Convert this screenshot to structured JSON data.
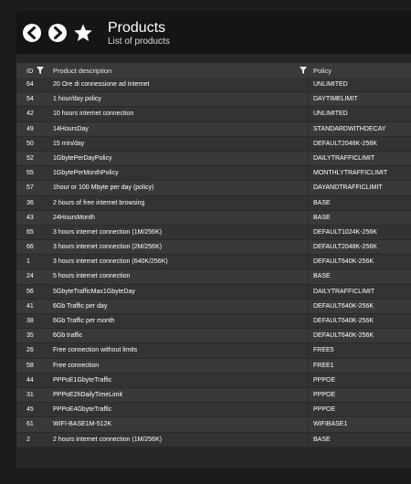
{
  "header": {
    "title": "Products",
    "subtitle": "List of products",
    "icons": [
      "back-circle-icon",
      "forward-circle-icon",
      "star-icon"
    ]
  },
  "columns": {
    "id": "ID",
    "description": "Product description",
    "policy": "Policy"
  },
  "rows": [
    {
      "id": "64",
      "description": "20 Ore di connessione ad Internet",
      "policy": "UNLIMITED"
    },
    {
      "id": "54",
      "description": "1 hour/day policy",
      "policy": "DAYTIMELIMIT"
    },
    {
      "id": "42",
      "description": "10 hours internet connection",
      "policy": "UNLIMITED"
    },
    {
      "id": "49",
      "description": "14HoursDay",
      "policy": "STANDARDWITHDECAY"
    },
    {
      "id": "50",
      "description": "15 min/day",
      "policy": "DEFAULT2048K-256K"
    },
    {
      "id": "52",
      "description": "1GbytePerDayPolicy",
      "policy": "DAILYTRAFFICLIMIT"
    },
    {
      "id": "55",
      "description": "1GbytePerMonthPolicy",
      "policy": "MONTHLYTRAFFICLIMIT"
    },
    {
      "id": "57",
      "description": "1hour or 100 Mbyte per day (policy)",
      "policy": "DAYANDTRAFFICLIMIT"
    },
    {
      "id": "36",
      "description": "2 hours of free internet browsing",
      "policy": "BASE"
    },
    {
      "id": "43",
      "description": "24HoursMonth",
      "policy": "BASE"
    },
    {
      "id": "65",
      "description": "3 hours internet connection (1M/256K)",
      "policy": "DEFAULT1024K-256K"
    },
    {
      "id": "66",
      "description": "3 hours internet connection (2M/256K)",
      "policy": "DEFAULT2048K-256K"
    },
    {
      "id": "1",
      "description": "3 hours internet connection (640K/256K)",
      "policy": "DEFAULT640K-256K"
    },
    {
      "id": "24",
      "description": "5 hours internet connection",
      "policy": "BASE"
    },
    {
      "id": "56",
      "description": "5GbyteTrafficMax1GbyteDay",
      "policy": "DAILYTRAFFICLIMIT"
    },
    {
      "id": "41",
      "description": "6Gb Traffic per day",
      "policy": "DEFAULT640K-256K"
    },
    {
      "id": "38",
      "description": "6Gb Traffic per month",
      "policy": "DEFAULT640K-256K"
    },
    {
      "id": "35",
      "description": "6Gb traffic",
      "policy": "DEFAULT640K-256K"
    },
    {
      "id": "26",
      "description": "Free connection without limits",
      "policy": "FREE5"
    },
    {
      "id": "58",
      "description": "Free connection",
      "policy": "FREE1"
    },
    {
      "id": "44",
      "description": "PPPoE1GbyteTraffic",
      "policy": "PPPOE"
    },
    {
      "id": "31",
      "description": "PPPoE2hDailyTimeLimit",
      "policy": "PPPOE"
    },
    {
      "id": "45",
      "description": "PPPoE4GbyteTraffic",
      "policy": "PPPOE"
    },
    {
      "id": "61",
      "description": "WIFI-BASE1M-512K",
      "policy": "WIFIBASE1"
    },
    {
      "id": "2",
      "description": "2 hours internet connection (1M/256K)",
      "policy": "BASE"
    }
  ]
}
